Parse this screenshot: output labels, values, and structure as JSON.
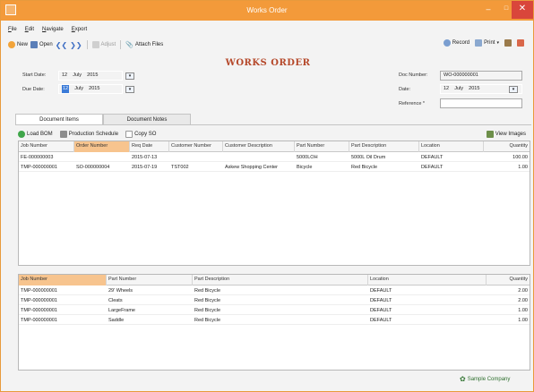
{
  "window": {
    "title": "Works Order"
  },
  "menu": [
    "File",
    "Edit",
    "Navigate",
    "Export"
  ],
  "toolbar": {
    "new": "New",
    "open": "Open",
    "adjust": "Adjust",
    "attach": "Attach Files",
    "record": "Record",
    "print": "Print"
  },
  "heading": "WORKS ORDER",
  "fields": {
    "start_date": {
      "label": "Start Date:",
      "day": "12",
      "month": "July",
      "year": "2015"
    },
    "due_date": {
      "label": "Due Date:",
      "day": "12",
      "month": "July",
      "year": "2015"
    },
    "doc_number": {
      "label": "Doc Number:",
      "value": "WO-000000001"
    },
    "date": {
      "label": "Date:",
      "day": "12",
      "month": "July",
      "year": "2015"
    },
    "reference": {
      "label": "Reference *",
      "value": ""
    }
  },
  "tabs": [
    "Document Items",
    "Document Notes"
  ],
  "items_toolbar": {
    "load_bom": "Load BOM",
    "production": "Production Schedule",
    "copy_so": "Copy SO",
    "view_images": "View Images"
  },
  "items_table": {
    "columns": [
      "Job Number",
      "Order Number",
      "Req Date",
      "Customer Number",
      "Customer Description",
      "Part Number",
      "Part Description",
      "Location",
      "Quantity"
    ],
    "rows": [
      [
        "FE-000000003",
        "",
        "2015-07-13",
        "",
        "",
        "5000LOH",
        "5000L Oil Drum",
        "DEFAULT",
        "100.00"
      ],
      [
        "TMP-000000001",
        "SO-000000004",
        "2015-07-19",
        "TST002",
        "Askew Shopping Center",
        "Bicycle",
        "Red Bicycle",
        "DEFAULT",
        "1.00"
      ]
    ]
  },
  "parts_table": {
    "columns": [
      "Job Number",
      "Part Number",
      "Part Description",
      "Location",
      "Quantity"
    ],
    "rows": [
      [
        "TMP-000000001",
        "29' Wheels",
        "Red Bicycle",
        "DEFAULT",
        "2.00"
      ],
      [
        "TMP-000000001",
        "Cleats",
        "Red Bicycle",
        "DEFAULT",
        "2.00"
      ],
      [
        "TMP-000000001",
        "LargeFrame",
        "Red Bicycle",
        "DEFAULT",
        "1.00"
      ],
      [
        "TMP-000000001",
        "Saddle",
        "Red Bicycle",
        "DEFAULT",
        "1.00"
      ]
    ]
  },
  "status": {
    "company": "Sample Company"
  },
  "colors": {
    "titlebar": "#f39a3a",
    "heading": "#b5482a",
    "selected_header": "#f7c48e"
  }
}
